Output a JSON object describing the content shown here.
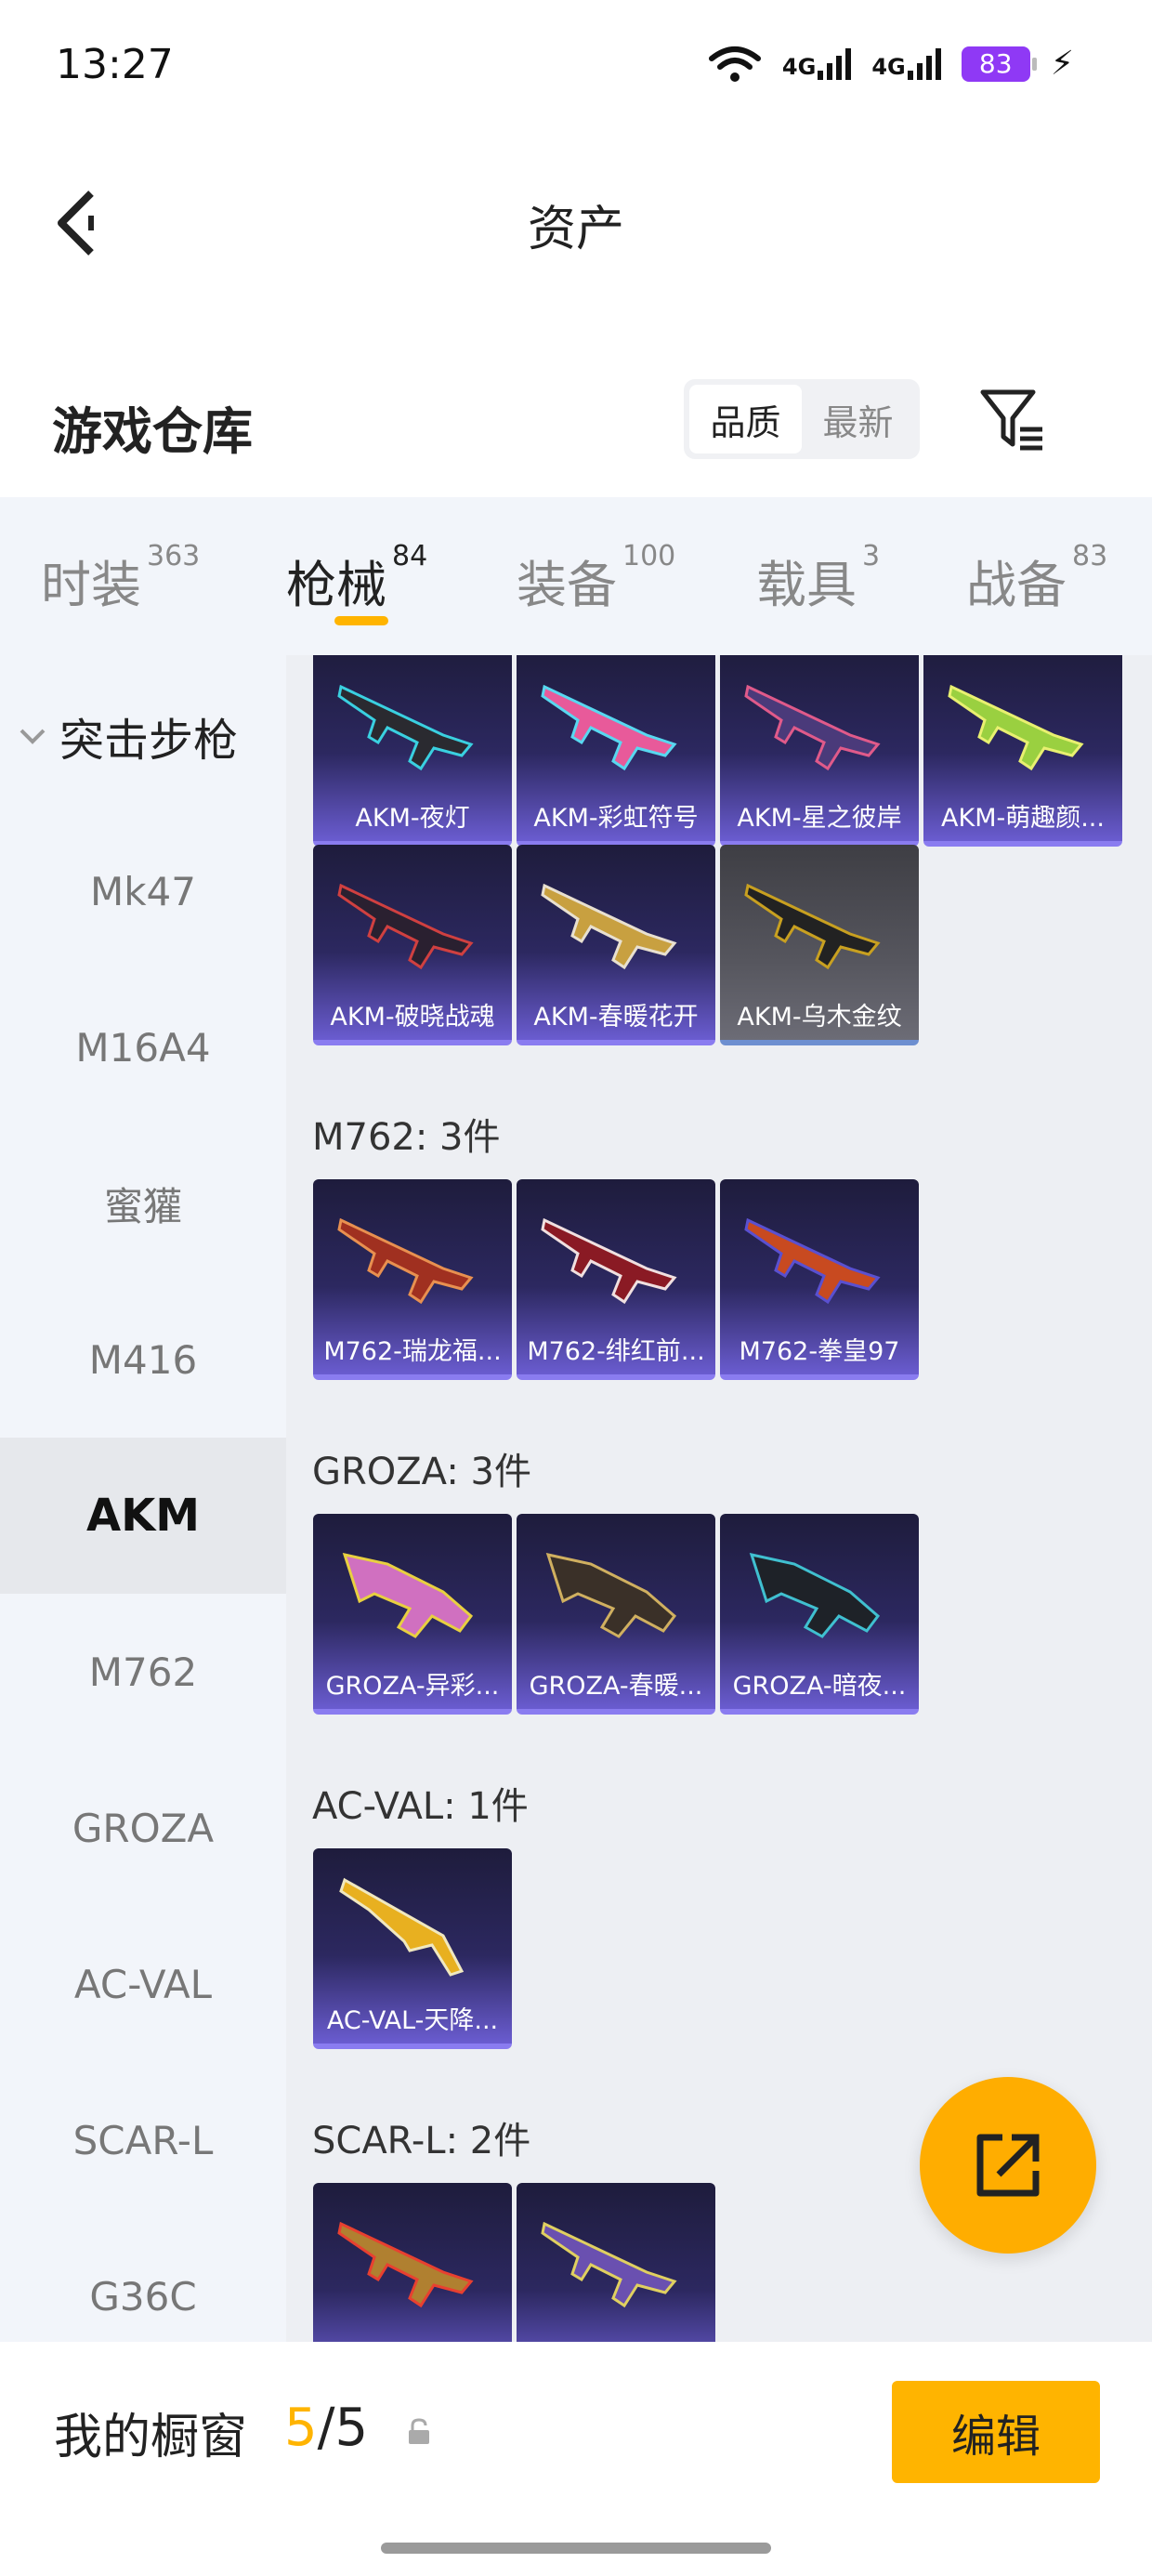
{
  "status_bar": {
    "time": "13:27",
    "signal1": "4G",
    "signal2": "4G",
    "battery": "83",
    "battery_color": "#8f39f5"
  },
  "header": {
    "title": "资产",
    "back_icon": "chevron-left-icon"
  },
  "warehouse": {
    "title": "游戏仓库",
    "sort_options": [
      "品质",
      "最新"
    ],
    "sort_selected": "品质",
    "filter_icon": "filter-icon"
  },
  "tabs": [
    {
      "label": "时装",
      "count": "363"
    },
    {
      "label": "枪械",
      "count": "84"
    },
    {
      "label": "装备",
      "count": "100"
    },
    {
      "label": "载具",
      "count": "3"
    },
    {
      "label": "战备",
      "count": "83"
    }
  ],
  "active_tab": "枪械",
  "accent_color": "#ffb400",
  "sidebar": {
    "category": "突击步枪",
    "items": [
      "Mk47",
      "M16A4",
      "蜜獾",
      "M416",
      "AKM",
      "M762",
      "GROZA",
      "AC-VAL",
      "SCAR-L",
      "G36C"
    ],
    "active": "AKM"
  },
  "groups": {
    "akm": {
      "items": [
        "AKM-夜灯",
        "AKM-彩虹符号",
        "AKM-星之彼岸",
        "AKM-萌趣颜...",
        "AKM-破晓战魂",
        "AKM-春暖花开",
        "AKM-乌木金纹"
      ]
    },
    "m762": {
      "title": "M762: 3件",
      "items": [
        "M762-瑞龙福...",
        "M762-绯红前...",
        "M762-拳皇97"
      ]
    },
    "groza": {
      "title": "GROZA: 3件",
      "items": [
        "GROZA-异彩...",
        "GROZA-春暖...",
        "GROZA-暗夜..."
      ]
    },
    "acval": {
      "title": "AC-VAL: 1件",
      "items": [
        "AC-VAL-天降..."
      ]
    },
    "scarl": {
      "title": "SCAR-L: 2件",
      "items": [
        "",
        ""
      ]
    }
  },
  "fab_icon": "share-external-icon",
  "bottom": {
    "window_label": "我的橱窗",
    "window_current": "5",
    "window_total": "/5",
    "edit_label": "编辑",
    "lock_icon": "lock-icon"
  }
}
